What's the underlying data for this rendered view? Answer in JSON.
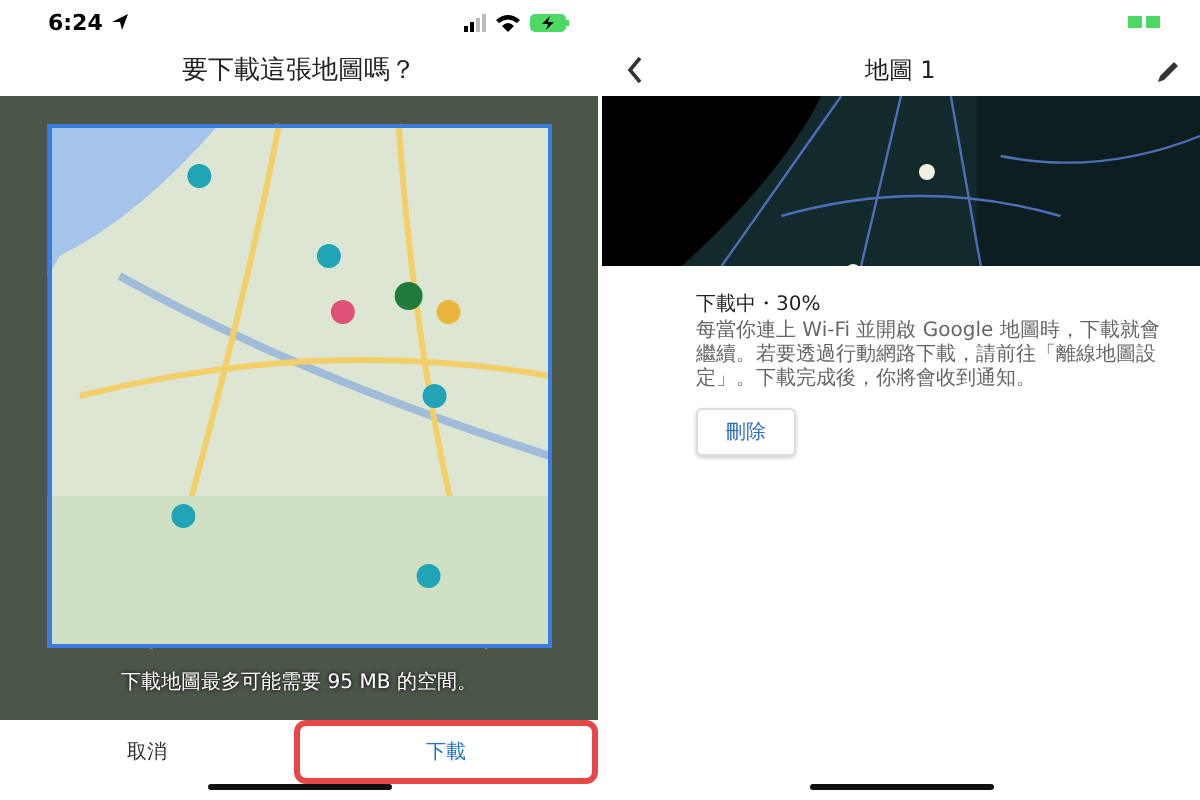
{
  "status_bar": {
    "time": "6:24"
  },
  "download_dialog": {
    "title": "要下載這張地圖嗎？",
    "caption": "下載地圖最多可能需要 95 MB 的空間。",
    "buttons": [
      {
        "label": "取消",
        "highlighted": false
      },
      {
        "label": "下載",
        "highlighted": true
      }
    ]
  },
  "map_detail": {
    "title": "地圖 1",
    "status": "下載中・30%",
    "message": "每當你連上 Wi-Fi 並開啟 Google 地圖時，下載就會繼續。若要透過行動網路下載，請前往「離線地圖設定」。下載完成後，你將會收到通知。",
    "button": "刪除"
  }
}
